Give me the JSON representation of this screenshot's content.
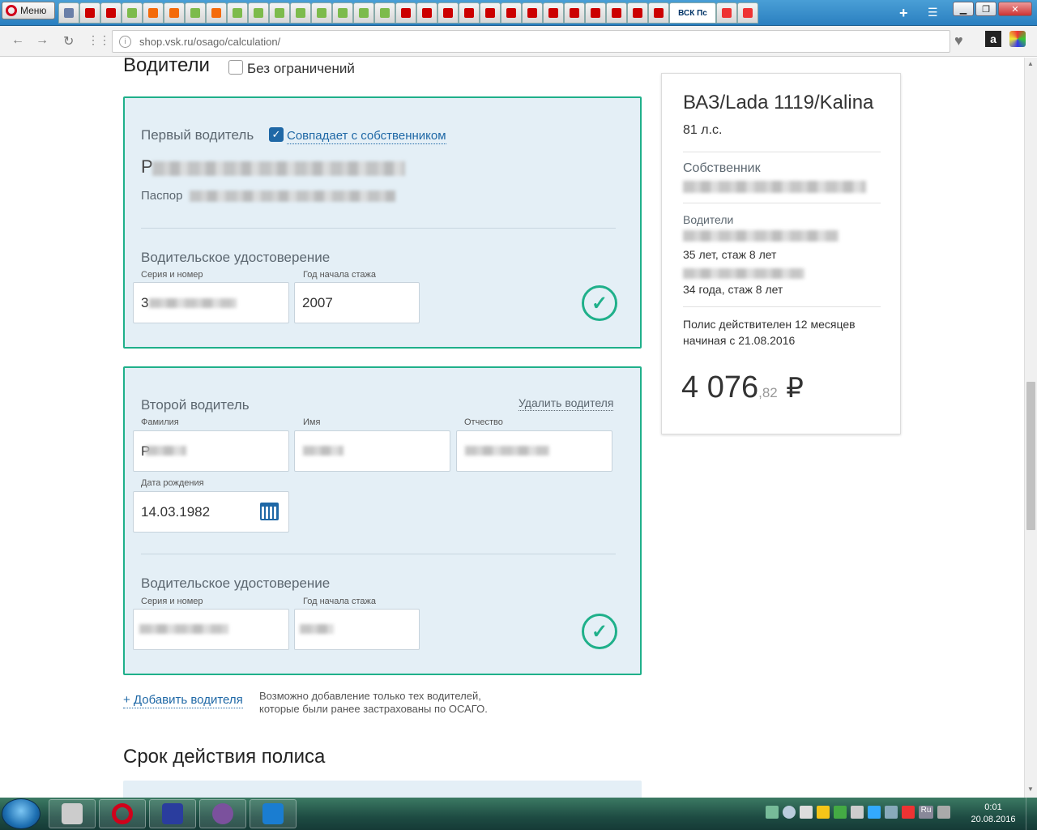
{
  "browser": {
    "menu_label": "Меню",
    "active_tab_title": "ВСК Пс",
    "url": "shop.vsk.ru/osago/calculation/",
    "tab_favicon_colors": [
      "#6a7fa8",
      "#c00",
      "#c00",
      "#7dbb4c",
      "#f46a0a",
      "#f46a0a",
      "#7dbb4c",
      "#f46a0a",
      "#7dbb4c",
      "#7dbb4c",
      "#7dbb4c",
      "#7dbb4c",
      "#7dbb4c",
      "#7dbb4c",
      "#7dbb4c",
      "#7dbb4c",
      "#c00",
      "#c00",
      "#c00",
      "#c00",
      "#c00",
      "#c00",
      "#c00",
      "#c00",
      "#c00",
      "#c00",
      "#c00",
      "#c00",
      "#c00",
      "#e33",
      "#e33"
    ]
  },
  "drivers": {
    "heading": "Водители",
    "unlimited_label": "Без ограничений",
    "first": {
      "title": "Первый водитель",
      "same_as_owner": "Совпадает с собственником",
      "passport_prefix": "Паспор",
      "license_title": "Водительское удостоверение",
      "series_label": "Серия и номер",
      "series_value_visible": "3",
      "year_label": "Год начала стажа",
      "year_value": "2007"
    },
    "second": {
      "title": "Второй водитель",
      "delete_link": "Удалить водителя",
      "surname_label": "Фамилия",
      "surname_visible": "Р",
      "name_label": "Имя",
      "patronymic_label": "Отчество",
      "birth_label": "Дата рождения",
      "birth_value": "14.03.1982",
      "license_title": "Водительское удостоверение",
      "series_label": "Серия и номер",
      "year_label": "Год начала стажа"
    },
    "add_link": "+ Добавить водителя",
    "add_note_line1": "Возможно добавление только тех водителей,",
    "add_note_line2": "которые были ранее застрахованы по ОСАГО."
  },
  "policy_term": {
    "heading": "Срок действия полиса"
  },
  "summary": {
    "car": "ВАЗ/Lada 1119/Kalina",
    "power": "81 л.с.",
    "owner_label": "Собственник",
    "drivers_label": "Водители",
    "driver1_info": "35 лет, стаж 8 лет",
    "driver2_info": "34 года, стаж 8 лет",
    "validity_line1": "Полис действителен 12 месяцев",
    "validity_line2": "начиная с 21.08.2016",
    "price_main": "4 076",
    "price_cents": ",82",
    "currency": "₽"
  },
  "taskbar": {
    "time": "0:01",
    "date": "20.08.2016",
    "lang": "Ru"
  }
}
